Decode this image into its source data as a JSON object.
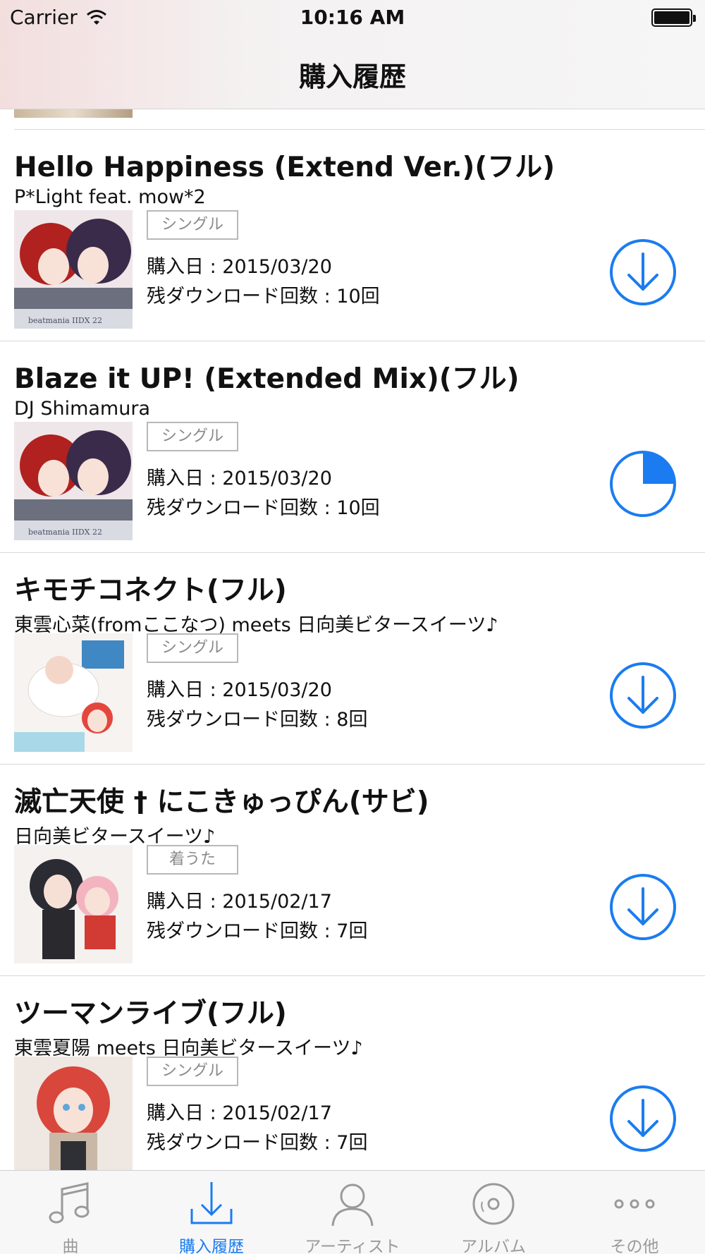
{
  "status_bar": {
    "carrier": "Carrier",
    "time": "10:16 AM",
    "battery_level": 1.0
  },
  "nav": {
    "title": "購入履歴"
  },
  "colors": {
    "accent": "#1a7cf0",
    "tab_inactive": "#9a9a9a",
    "badge_border": "#b8b8b8"
  },
  "purchases": [
    {
      "title": "Hello Happiness (Extend Ver.)(フル)",
      "artist": "P*Light feat. mow*2",
      "type": "シングル",
      "purchase_date": "購入日 : 2015/03/20",
      "remaining": "残ダウンロード回数 : 10回",
      "state": "download",
      "jacket": "beatmania IIDX 22 PENDUAL cover"
    },
    {
      "title": "Blaze it UP! (Extended Mix)(フル)",
      "artist": "DJ Shimamura",
      "type": "シングル",
      "purchase_date": "購入日 : 2015/03/20",
      "remaining": "残ダウンロード回数 : 10回",
      "state": "downloading",
      "progress": 0.25,
      "jacket": "beatmania IIDX 22 PENDUAL cover"
    },
    {
      "title": "キモチコネクト(フル)",
      "artist": "東雲心菜(fromここなつ) meets 日向美ビタースイーツ♪",
      "type": "シングル",
      "purchase_date": "購入日 : 2015/03/20",
      "remaining": "残ダウンロード回数 : 8回",
      "state": "download",
      "jacket": "anime girl illustration (light)"
    },
    {
      "title": "滅亡天使 † にこきゅっぴん(サビ)",
      "artist": "日向美ビタースイーツ♪",
      "type": "着うた",
      "purchase_date": "購入日 : 2015/02/17",
      "remaining": "残ダウンロード回数 : 7回",
      "state": "download",
      "jacket": "anime girls illustration (dark dress)"
    },
    {
      "title": "ツーマンライブ(フル)",
      "artist": "東雲夏陽 meets 日向美ビタースイーツ♪",
      "type": "シングル",
      "purchase_date": "購入日 : 2015/02/17",
      "remaining": "残ダウンロード回数 : 7回",
      "state": "download",
      "jacket": "anime girl with red hair"
    }
  ],
  "tabs": [
    {
      "label": "曲",
      "icon": "music-note-icon",
      "active": false
    },
    {
      "label": "購入履歴",
      "icon": "download-tray-icon",
      "active": true
    },
    {
      "label": "アーティスト",
      "icon": "person-icon",
      "active": false
    },
    {
      "label": "アルバム",
      "icon": "disc-icon",
      "active": false
    },
    {
      "label": "その他",
      "icon": "more-dots-icon",
      "active": false
    }
  ]
}
